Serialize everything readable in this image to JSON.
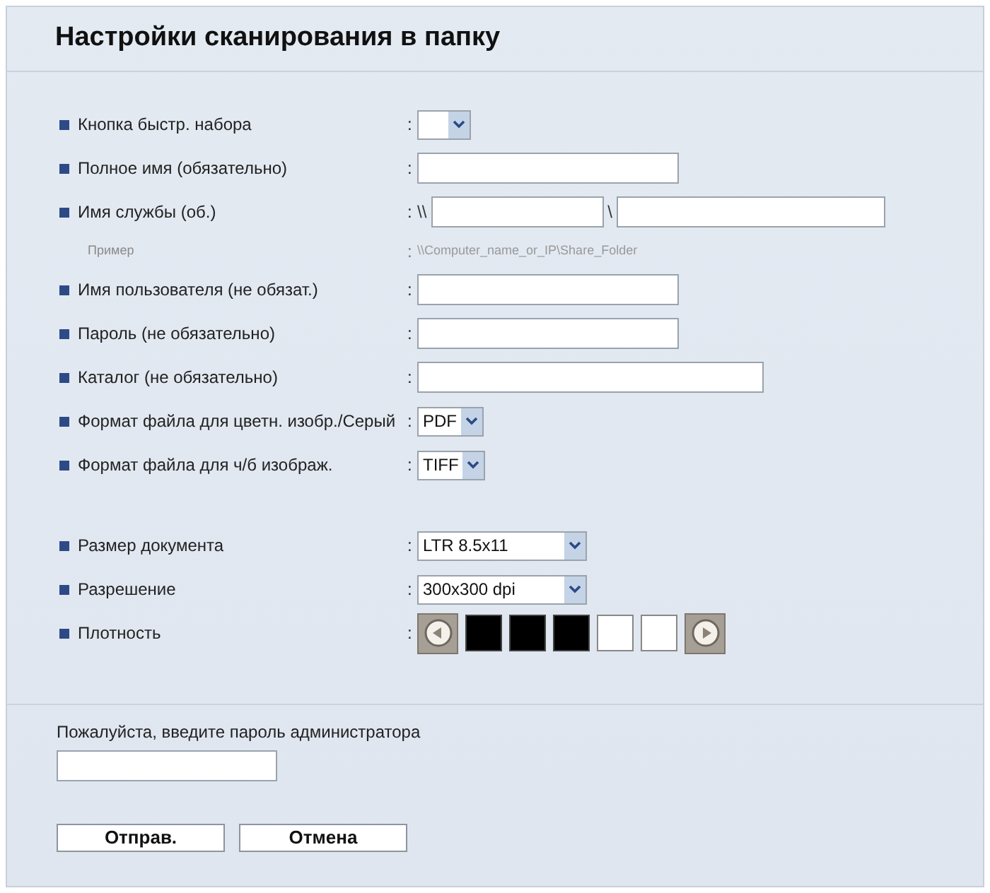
{
  "title": "Настройки сканирования в папку",
  "groups": [
    [
      {
        "kind": "select",
        "label": "Кнопка быстр. набора",
        "separator": ":"
      },
      {
        "kind": "text",
        "label": "Полное имя (обязательно)",
        "separator": ":"
      },
      {
        "kind": "share",
        "label": "Имя службы (об.)",
        "separator": ":",
        "prefix": "\\\\",
        "middle": "\\"
      },
      {
        "kind": "example",
        "label": "Пример",
        "separator": ":",
        "value": "\\\\Computer_name_or_IP\\Share_Folder"
      },
      {
        "kind": "text",
        "label": "Имя пользователя (не обязат.)",
        "separator": ":"
      },
      {
        "kind": "text",
        "label": "Пароль (не обязательно)",
        "separator": ":"
      },
      {
        "kind": "text",
        "label": "Каталог (не обязательно)",
        "separator": ":"
      },
      {
        "kind": "select",
        "label": "Формат файла для цветн. изобр./Серый",
        "separator": ":",
        "value": "PDF"
      },
      {
        "kind": "select",
        "label": "Формат файла для ч/б изображ.",
        "separator": ":",
        "value": "TIFF"
      }
    ],
    [
      {
        "kind": "select",
        "label": "Размер документа",
        "separator": ":",
        "value": "LTR 8.5x11"
      },
      {
        "kind": "select",
        "label": "Разрешение",
        "separator": ":",
        "value": "300x300 dpi"
      },
      {
        "kind": "density",
        "label": "Плотность",
        "separator": ":",
        "cells": [
          {
            "filled": true
          },
          {
            "filled": true
          },
          {
            "filled": true
          },
          {
            "filled": false
          },
          {
            "filled": false
          }
        ]
      }
    ]
  ],
  "admin": {
    "prompt": "Пожалуйста, введите пароль администратора"
  },
  "buttons": [
    "Отправ.",
    "Отмена"
  ]
}
